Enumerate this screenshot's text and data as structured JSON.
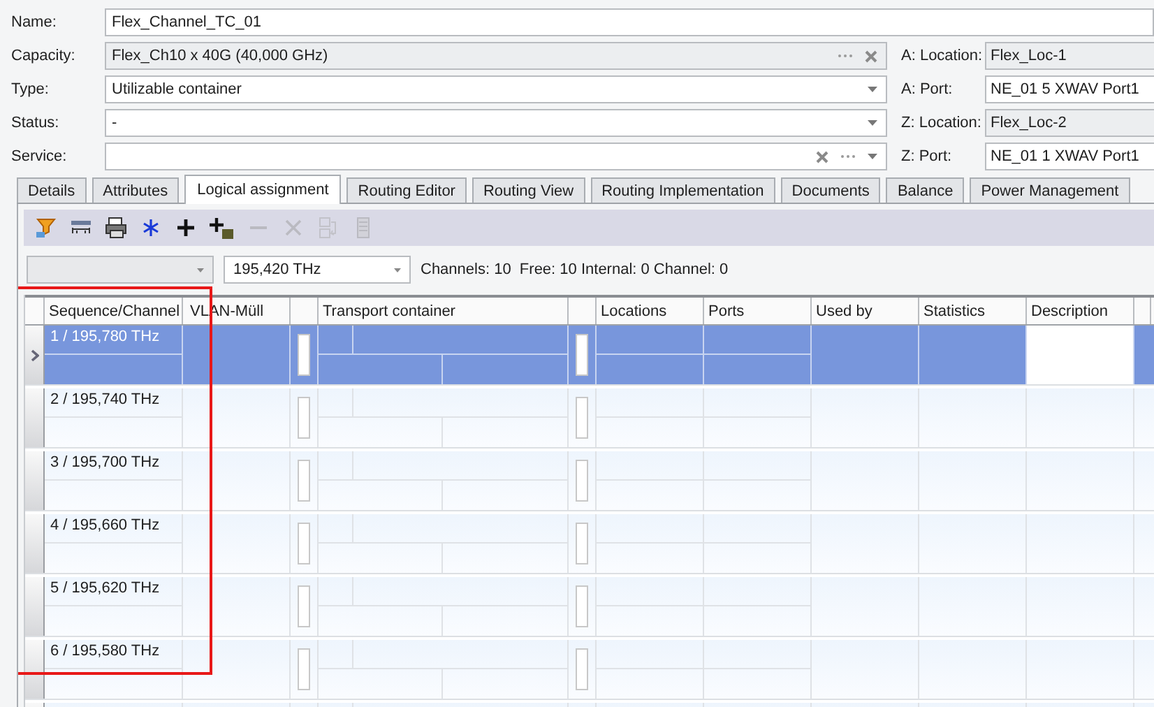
{
  "form": {
    "fields": [
      {
        "label": "Name:",
        "value": "Flex_Channel_TC_01",
        "kind": "text",
        "readonly": false
      },
      {
        "label": "Capacity:",
        "value": "Flex_Ch10 x 40G (40,000 GHz)",
        "kind": "lookup",
        "readonly": true
      },
      {
        "label": "Type:",
        "value": "Utilizable container",
        "kind": "dropdown",
        "readonly": false
      },
      {
        "label": "Status:",
        "value": "-",
        "kind": "dropdown",
        "readonly": false
      },
      {
        "label": "Service:",
        "kind": "picker",
        "readonly": false
      }
    ],
    "endpoints": [
      {
        "label": "A: Location:",
        "value": "Flex_Loc-1",
        "readonly": true
      },
      {
        "label": "A: Port:",
        "value": "NE_01 5 XWAV Port1",
        "readonly": false
      },
      {
        "label": "Z: Location:",
        "value": "Flex_Loc-2",
        "readonly": true
      },
      {
        "label": "Z: Port:",
        "value": "NE_01 1 XWAV Port1",
        "readonly": false
      }
    ]
  },
  "tabs": [
    {
      "label": "Details",
      "selected": false
    },
    {
      "label": "Attributes",
      "selected": false
    },
    {
      "label": "Logical assignment",
      "selected": true
    },
    {
      "label": "Routing Editor",
      "selected": false
    },
    {
      "label": "Routing View",
      "selected": false
    },
    {
      "label": "Routing Implementation",
      "selected": false
    },
    {
      "label": "Documents",
      "selected": false
    },
    {
      "label": "Balance",
      "selected": false
    },
    {
      "label": "Power Management",
      "selected": false
    }
  ],
  "toolbar": {
    "tools": [
      {
        "disabled": false
      },
      {
        "disabled": false
      },
      {
        "disabled": false
      },
      {
        "disabled": false
      },
      {
        "disabled": false
      },
      {
        "disabled": false
      },
      {
        "disabled": true
      },
      {
        "disabled": true
      },
      {
        "disabled": true
      },
      {
        "disabled": true
      }
    ]
  },
  "filter": {
    "first_combo": {
      "disabled": true
    },
    "frequency": "195,420 THz",
    "summary": "Channels: 10  Free: 10 Internal: 0 Channel: 0"
  },
  "table": {
    "columns": [
      "Sequence/Channel",
      "VLAN-Müll",
      "Transport container",
      "Locations",
      "Ports",
      "Used by",
      "Statistics",
      "Description"
    ],
    "rows": [
      {
        "sequence": "1 / 195,780 THz",
        "selected": true
      },
      {
        "sequence": "2 / 195,740 THz",
        "selected": false
      },
      {
        "sequence": "3 / 195,700 THz",
        "selected": false
      },
      {
        "sequence": "4 / 195,660 THz",
        "selected": false
      },
      {
        "sequence": "5 / 195,620 THz",
        "selected": false
      },
      {
        "sequence": "6 / 195,580 THz",
        "selected": false
      },
      {
        "selected": false
      }
    ]
  },
  "annotations": [
    {
      "kind": "rectangle"
    }
  ]
}
